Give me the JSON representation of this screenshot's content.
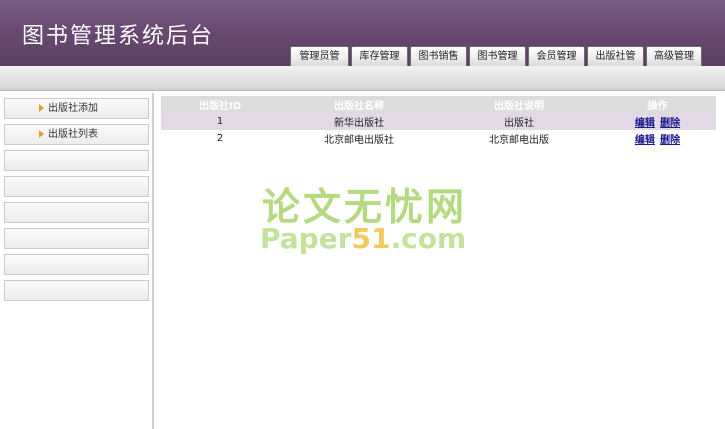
{
  "header": {
    "title": "图书管理系统后台"
  },
  "tabs": [
    {
      "label": "管理员管理"
    },
    {
      "label": "库存管理"
    },
    {
      "label": "图书销售"
    },
    {
      "label": "图书管理"
    },
    {
      "label": "会员管理"
    },
    {
      "label": "出版社管理"
    },
    {
      "label": "高级管理"
    }
  ],
  "sidebar": {
    "items": [
      {
        "label": "出版社添加"
      },
      {
        "label": "出版社列表"
      },
      {
        "label": ""
      },
      {
        "label": ""
      },
      {
        "label": ""
      },
      {
        "label": ""
      },
      {
        "label": ""
      },
      {
        "label": ""
      }
    ]
  },
  "table": {
    "headers": [
      "出版社ID",
      "出版社名称",
      "出版社说明",
      "操作"
    ],
    "rows": [
      {
        "id": "1",
        "name": "新华出版社",
        "desc": "出版社",
        "edit": "编辑",
        "del": "删除"
      },
      {
        "id": "2",
        "name": "北京邮电出版社",
        "desc": "北京邮电出版",
        "edit": "编辑",
        "del": "删除"
      }
    ]
  },
  "watermark": {
    "line1": "论文无忧网",
    "line2_a": "Paper",
    "line2_b": "51",
    "line2_c": ".com"
  }
}
